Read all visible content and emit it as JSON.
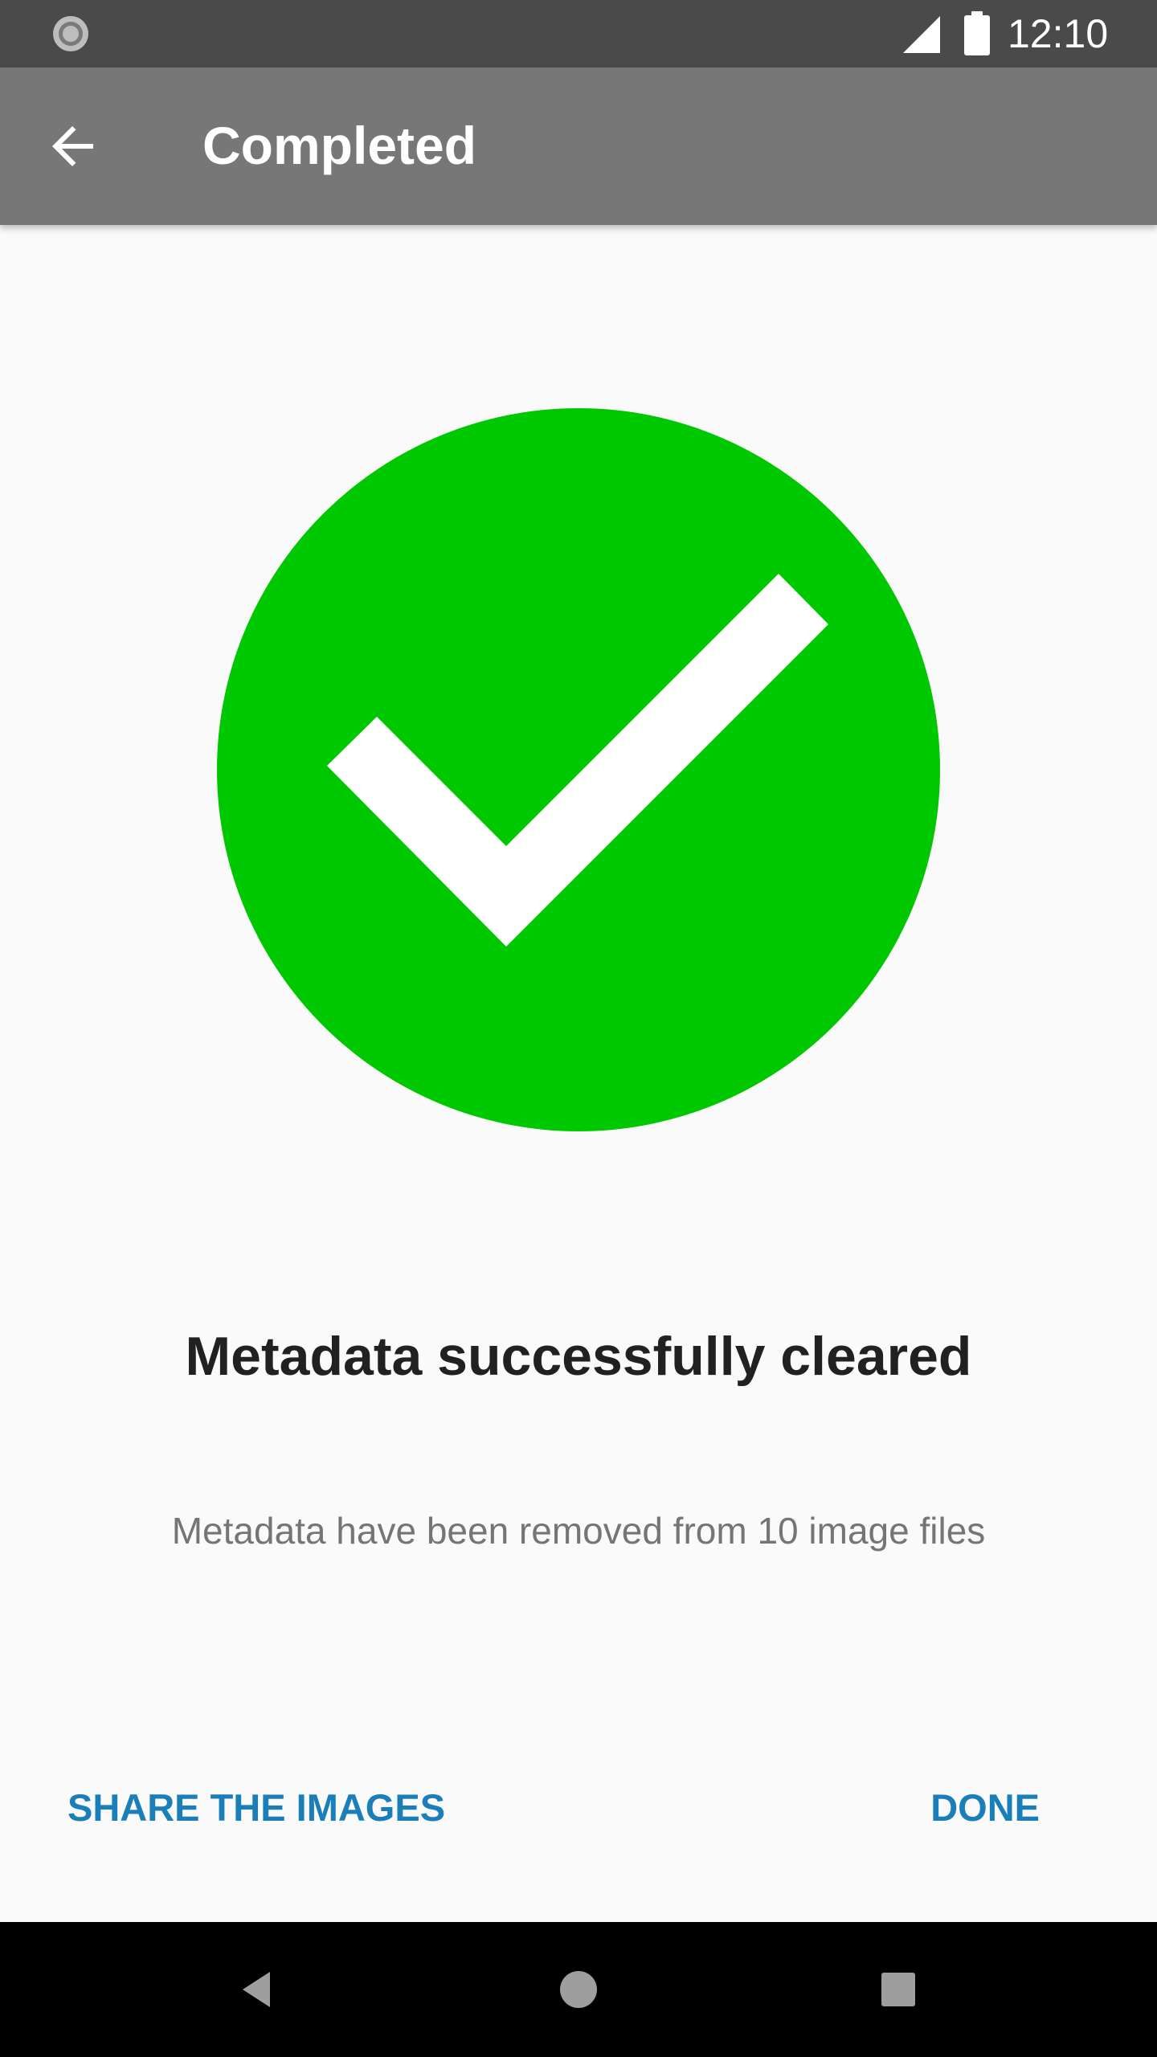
{
  "status_bar": {
    "time": "12:10",
    "icons": [
      "sync-icon",
      "cell-signal-icon",
      "battery-icon"
    ]
  },
  "app_bar": {
    "title": "Completed",
    "back_icon": "arrow-back-icon"
  },
  "main": {
    "success_icon": "check-circle-icon",
    "success_color": "#00c800",
    "headline": "Metadata successfully cleared",
    "message": "Metadata have been removed from 10 image files"
  },
  "actions": {
    "share_label": "SHARE THE IMAGES",
    "done_label": "DONE",
    "accent_color": "#1a7fb8"
  },
  "nav_bar": {
    "icons": [
      "nav-back-icon",
      "nav-home-icon",
      "nav-recents-icon"
    ]
  }
}
